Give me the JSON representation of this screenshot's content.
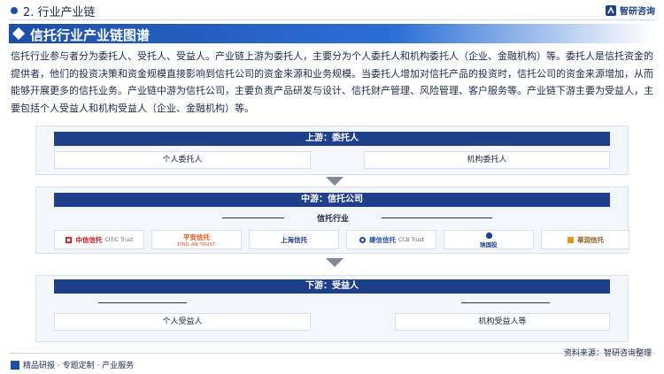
{
  "header": {
    "section": "2. 行业产业链",
    "brand": "智研咨询"
  },
  "title": "信托行业产业链图谱",
  "intro": "信托行业参与者分为委托人、受托人、受益人。产业链上游为委托人，主要分为个人委托人和机构委托人（企业、金融机构）等。委托人是信托资金的提供者，他们的投资决策和资金规模直接影响到信托公司的资金来源和业务规模。当委托人增加对信托产品的投资时，信托公司的资金来源增加，从而能够开展更多的信托业务。产业链中游为信托公司，主要负责产品研发与设计、信托财产管理、风险管理、客户服务等。产业链下游主要为受益人，主要包括个人受益人和机构受益人（企业、金融机构）等。",
  "upstream": {
    "label": "上游：委托人",
    "items": [
      "个人委托人",
      "机构委托人"
    ]
  },
  "midstream": {
    "label": "中游：信托公司",
    "sub": "信托行业",
    "logos": [
      {
        "name": "中信信托",
        "en": "CITIC Trust",
        "color": "#c8161d"
      },
      {
        "name": "平安信托",
        "en": "PING AN TRUST",
        "color": "#e8541f"
      },
      {
        "name": "上海信托",
        "en": "",
        "color": "#1e3f8a"
      },
      {
        "name": "建信信托",
        "en": "CCB Trust",
        "color": "#1e4fa8"
      },
      {
        "name": "陕国投",
        "en": "",
        "color": "#1e3f8a"
      },
      {
        "name": "華润信托",
        "en": "",
        "color": "#d99a1e"
      }
    ]
  },
  "downstream": {
    "label": "下游：受益人",
    "items": [
      "个人受益人",
      "机构受益人等"
    ]
  },
  "footer": {
    "left": "精品研报 · 专题定制 · 产业服务",
    "source": "资料来源：智研咨询整理"
  }
}
